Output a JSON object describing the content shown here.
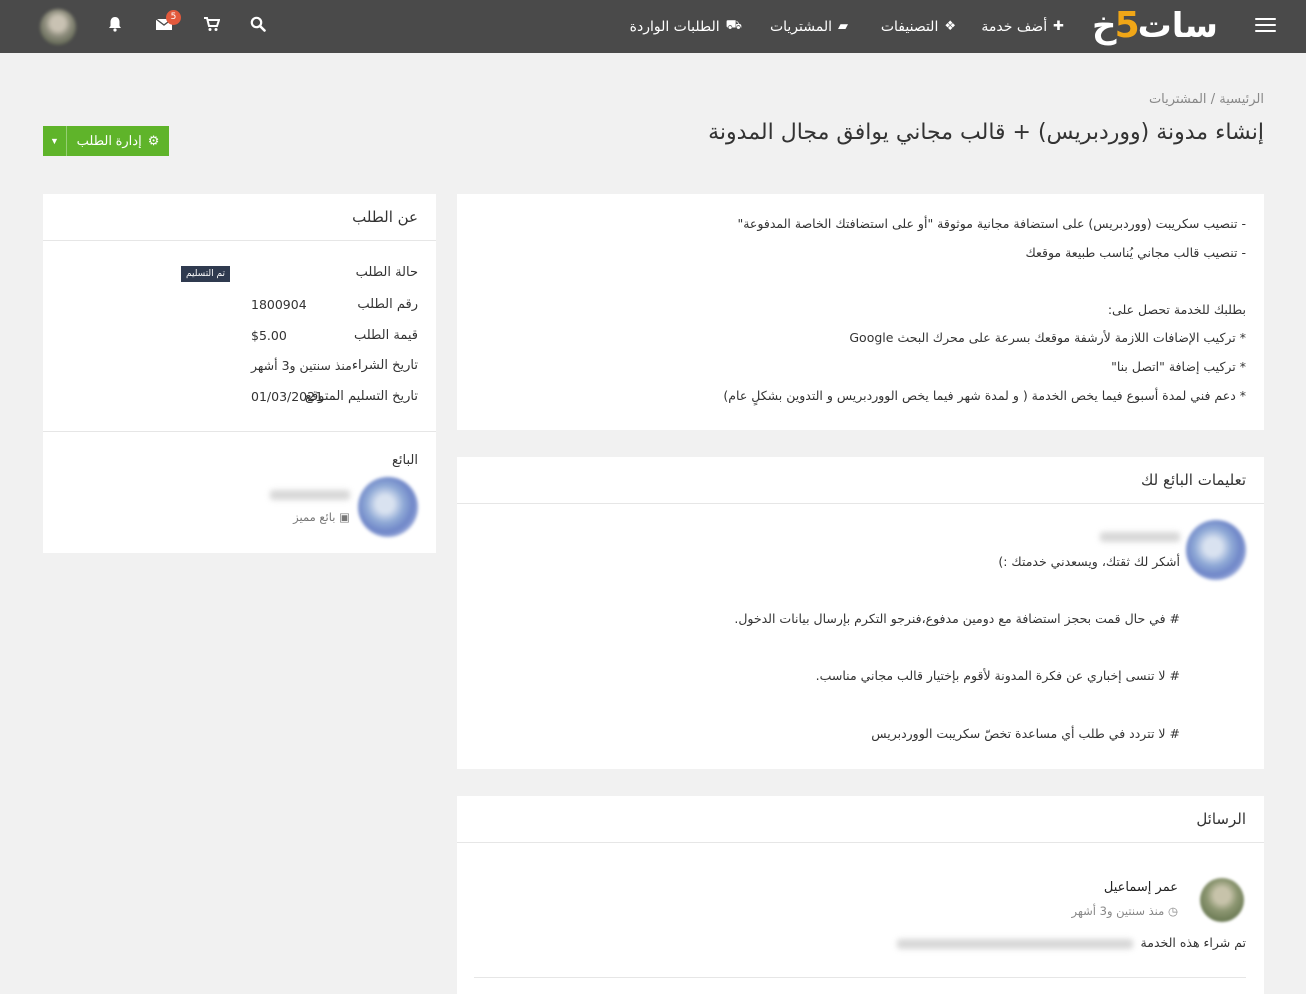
{
  "header": {
    "logo_text_left": "خ",
    "logo_number": "5",
    "logo_text_right": "سات",
    "nav": [
      {
        "label": "أضف خدمة",
        "icon": "plus-icon"
      },
      {
        "label": "التصنيفات",
        "icon": "cubes-icon"
      },
      {
        "label": "المشتريات",
        "icon": "folder-open-icon"
      },
      {
        "label": "الطلبات الواردة",
        "icon": "truck-icon"
      }
    ],
    "messages_badge": "5"
  },
  "breadcrumb": {
    "home": "الرئيسية",
    "separator": "/",
    "current": "المشتريات"
  },
  "page_title": "إنشاء مدونة (ووردبريس) + قالب مجاني يوافق مجال المدونة",
  "manage_button": "إدارة الطلب",
  "description": [
    "- تنصيب سكريبت (ووردبريس) على استضافة مجانية موثوقة \"أو على استضافتك الخاصة المدفوعة\"",
    "- تنصيب قالب مجاني يُناسب طبيعة موقعك",
    "",
    "بطلبك للخدمة تحصل على:",
    "* تركيب الإضافات اللازمة لأرشفة موقعك بسرعة على محرك البحث Google",
    "* تركيب إضافة \"اتصل بنا\"",
    "* دعم فني لمدة أسبوع فيما يخص الخدمة ( و لمدة شهر فيما يخص الووردبريس و التدوين بشكلٍ عام)"
  ],
  "instructions": {
    "title": "تعليمات البائع لك",
    "lines": [
      "أشكر لك ثقتك، ويسعدني خدمتك :)",
      "# في حال قمت بحجز استضافة مع دومين مدفوع،فنرجو التكرم بإرسال بيانات الدخول.",
      "# لا تنسى إخباري عن فكرة المدونة لأقوم بإختيار قالب مجاني مناسب.",
      "# لا تتردد في طلب أي مساعدة تخصّ سكريبت الووردبريس"
    ]
  },
  "messages": {
    "title": "الرسائل",
    "items": [
      {
        "author": "عمر إسماعيل",
        "time": "منذ سنتين و3 أشهر",
        "text": "تم شراء هذه الخدمة"
      }
    ]
  },
  "about": {
    "title": "عن الطلب",
    "status_label": "حالة الطلب",
    "status_value": "تم التسليم",
    "rows": [
      {
        "label": "رقم الطلب",
        "value": "1800904"
      },
      {
        "label": "قيمة الطلب",
        "value": "$5.00"
      },
      {
        "label": "تاريخ الشراء",
        "value": "منذ سنتين و3 أشهر"
      },
      {
        "label": "تاريخ التسليم المتوقع",
        "value": "01/03/2021"
      }
    ],
    "seller_label": "البائع",
    "seller_role": "بائع مميز"
  },
  "colors": {
    "topbar": "#4a4a4a",
    "accent_green": "#5fb42a",
    "logo_orange": "#f0a617",
    "badge": "#e2593c",
    "status_badge": "#2f3a4f"
  }
}
